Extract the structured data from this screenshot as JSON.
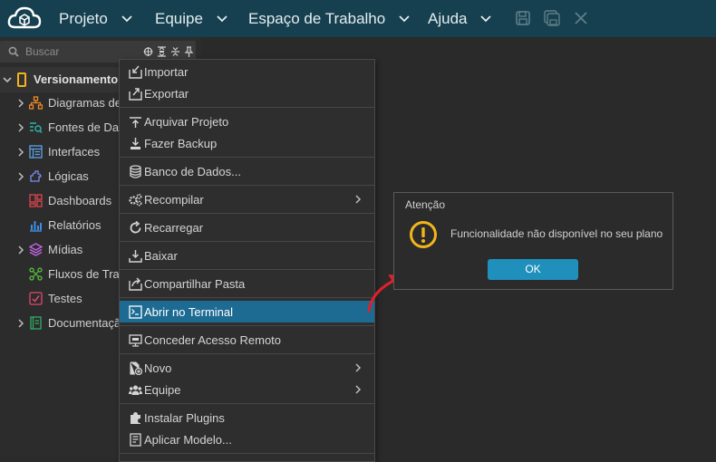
{
  "topbar": {
    "menus": [
      {
        "label": "Projeto"
      },
      {
        "label": "Equipe"
      },
      {
        "label": "Espaço de Trabalho"
      },
      {
        "label": "Ajuda"
      }
    ],
    "icons": [
      "cloud-logo-icon",
      "save-icon",
      "save-all-icon",
      "close-icon"
    ]
  },
  "sidebar": {
    "search_placeholder": "Buscar",
    "root": {
      "label": "Versionamento"
    },
    "items": [
      {
        "label": "Diagramas de",
        "icon": "diagram-icon",
        "has_arrow": true
      },
      {
        "label": "Fontes de Dad",
        "icon": "datasource-icon",
        "has_arrow": true
      },
      {
        "label": "Interfaces",
        "icon": "interface-icon",
        "has_arrow": true
      },
      {
        "label": "Lógicas",
        "icon": "logic-icon",
        "has_arrow": true
      },
      {
        "label": "Dashboards",
        "icon": "dashboard-icon",
        "has_arrow": false
      },
      {
        "label": "Relatórios",
        "icon": "report-icon",
        "has_arrow": false
      },
      {
        "label": "Mídias",
        "icon": "media-icon",
        "has_arrow": true
      },
      {
        "label": "Fluxos de Trab",
        "icon": "flow-icon",
        "has_arrow": false
      },
      {
        "label": "Testes",
        "icon": "test-icon",
        "has_arrow": false
      },
      {
        "label": "Documentação",
        "icon": "documentation-icon",
        "has_arrow": true
      }
    ]
  },
  "context_menu": {
    "items": [
      {
        "label": "Importar"
      },
      {
        "label": "Exportar"
      },
      {
        "label": "Arquivar Projeto"
      },
      {
        "label": "Fazer Backup"
      },
      {
        "label": "Banco de Dados..."
      },
      {
        "label": "Recompilar"
      },
      {
        "label": "Recarregar"
      },
      {
        "label": "Baixar"
      },
      {
        "label": "Compartilhar Pasta"
      },
      {
        "label": "Abrir no Terminal"
      },
      {
        "label": "Conceder Acesso Remoto"
      },
      {
        "label": "Novo"
      },
      {
        "label": "Equipe"
      },
      {
        "label": "Instalar Plugins"
      },
      {
        "label": "Aplicar Modelo..."
      }
    ],
    "active_item": "Abrir no Terminal"
  },
  "dialog": {
    "title": "Atenção",
    "message": "Funcionalidade não disponível no seu plano",
    "ok_label": "OK"
  },
  "colors": {
    "topbar": "#16404f",
    "accent": "#1d6b93",
    "ok_button": "#1f8fbc",
    "warning": "#f2b51b",
    "annotation_arrow": "#e0202a"
  }
}
